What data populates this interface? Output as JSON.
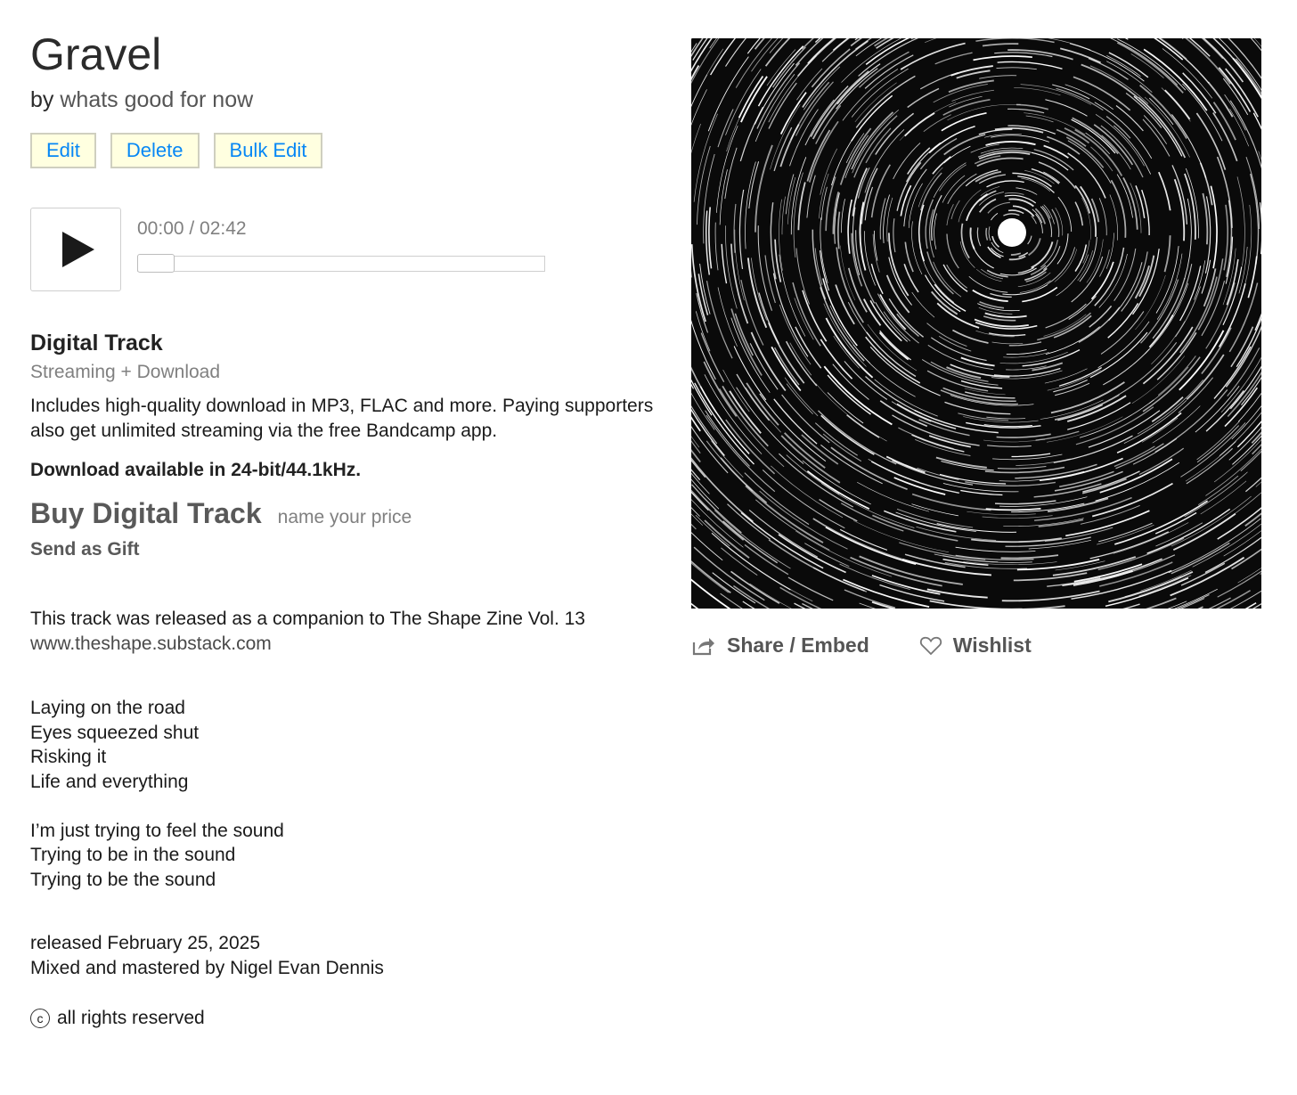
{
  "track": {
    "title": "Gravel",
    "by_prefix": "by",
    "artist": "whats good for now"
  },
  "admin": {
    "edit_label": "Edit",
    "delete_label": "Delete",
    "bulk_edit_label": "Bulk Edit",
    "button_bg": "#ffffe0",
    "button_text_color": "#0687f5"
  },
  "player": {
    "time_display": "00:00 / 02:42",
    "play_icon": "play-icon",
    "progress_fraction": 0
  },
  "purchase": {
    "format_title": "Digital Track",
    "format_subtitle": "Streaming + Download",
    "description": "Includes high-quality download in MP3, FLAC and more. Paying supporters also get unlimited streaming via the free Bandcamp app.",
    "download_note": "Download available in 24-bit/44.1kHz.",
    "buy_label": "Buy Digital Track",
    "price_note": "name your price",
    "gift_label": "Send as Gift"
  },
  "about": {
    "text": "This track was released as a companion to The Shape Zine Vol. 13",
    "link": "www.theshape.substack.com"
  },
  "lyrics": {
    "stanza1": {
      "line1": "Laying on the road",
      "line2": "Eyes squeezed shut",
      "line3": "Risking it",
      "line4": "Life and everything"
    },
    "stanza2": {
      "line1": "I’m just trying to feel the sound",
      "line2": "Trying to be in the sound",
      "line3": "Trying to be the sound"
    }
  },
  "credits": {
    "released": "released February 25, 2025",
    "mixed": "Mixed and mastered by Nigel Evan Dennis"
  },
  "license": {
    "icon": "copyright-icon",
    "text": "all rights reserved"
  },
  "share": {
    "share_label": "Share / Embed",
    "share_icon": "share-icon",
    "wishlist_label": "Wishlist",
    "wishlist_icon": "heart-icon"
  }
}
